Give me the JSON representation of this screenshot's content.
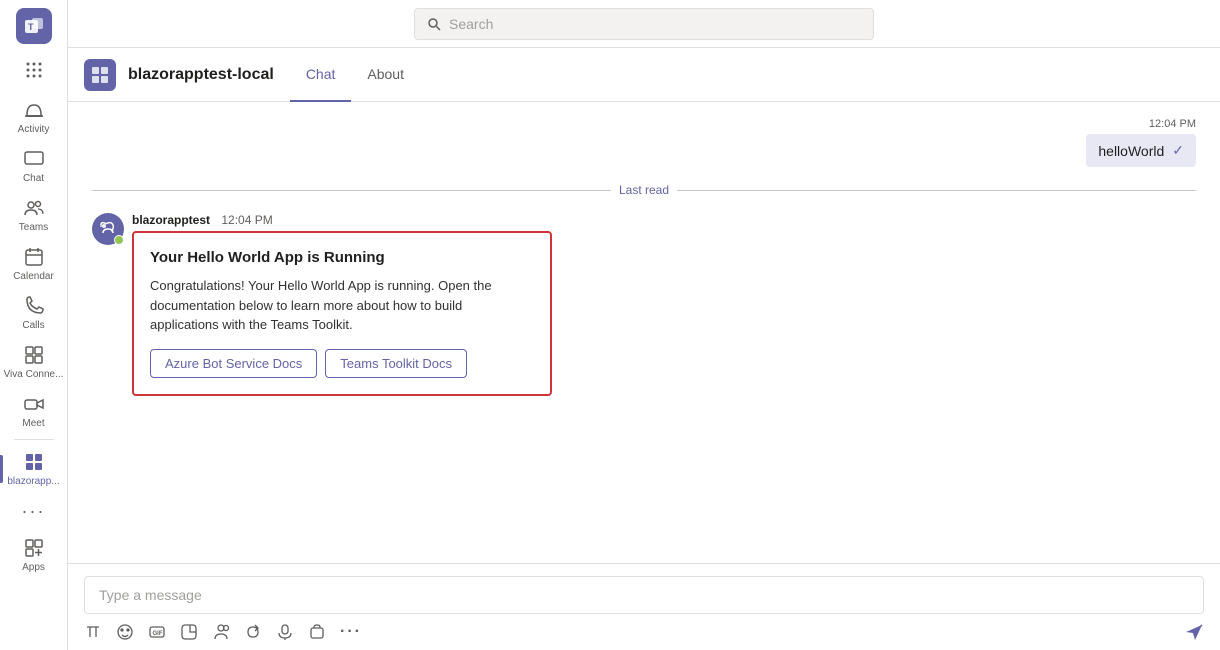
{
  "topbar": {
    "search_placeholder": "Search"
  },
  "sidebar": {
    "items": [
      {
        "id": "activity",
        "label": "Activity"
      },
      {
        "id": "chat",
        "label": "Chat"
      },
      {
        "id": "teams",
        "label": "Teams"
      },
      {
        "id": "calendar",
        "label": "Calendar"
      },
      {
        "id": "calls",
        "label": "Calls"
      },
      {
        "id": "viva",
        "label": "Viva Conne..."
      },
      {
        "id": "meet",
        "label": "Meet"
      },
      {
        "id": "blazorapp",
        "label": "blazorapp..."
      }
    ]
  },
  "header": {
    "app_name": "blazorapptest-local",
    "tabs": [
      {
        "id": "chat",
        "label": "Chat",
        "active": true
      },
      {
        "id": "about",
        "label": "About",
        "active": false
      }
    ]
  },
  "chat": {
    "sent_message_time": "12:04 PM",
    "sent_message_text": "helloWorld",
    "last_read_label": "Last read",
    "bot_sender": "blazorapptest",
    "bot_time": "12:04 PM",
    "card": {
      "title": "Your Hello World App is Running",
      "body": "Congratulations! Your Hello World App is running. Open the documentation below to learn more about how to build applications with the Teams Toolkit.",
      "button1": "Azure Bot Service Docs",
      "button2": "Teams Toolkit Docs"
    },
    "input_placeholder": "Type a message"
  },
  "colors": {
    "accent": "#6264a7",
    "red_border": "#d13438",
    "green_badge": "#92c353"
  }
}
